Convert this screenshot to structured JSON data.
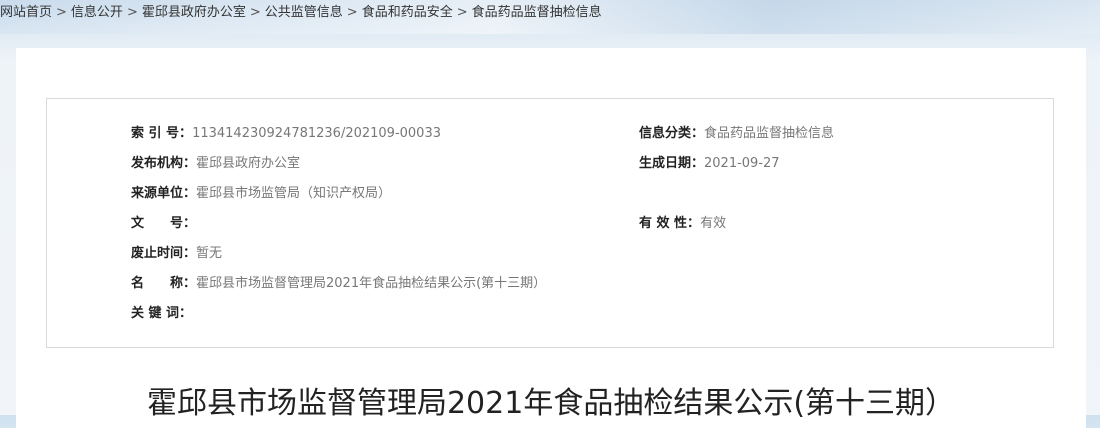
{
  "breadcrumb": {
    "items": [
      "网站首页",
      "信息公开",
      "霍邱县政府办公室",
      "公共监管信息",
      "食品和药品安全",
      "食品药品监督抽检信息"
    ],
    "separator": ">"
  },
  "meta": {
    "index_label": "索 引 号：",
    "index_value": "113414230924781236/202109-00033",
    "category_label": "信息分类：",
    "category_value": "食品药品监督抽检信息",
    "publisher_label": "发布机构：",
    "publisher_value": "霍邱县政府办公室",
    "date_label": "生成日期：",
    "date_value": "2021-09-27",
    "source_label": "来源单位：",
    "source_value": "霍邱县市场监管局（知识产权局）",
    "doc_no_label": "文　　号：",
    "doc_no_value": "",
    "validity_label": "有 效 性：",
    "validity_value": "有效",
    "repeal_label": "废止时间：",
    "repeal_value": "暂无",
    "name_label": "名　　称：",
    "name_value": "霍邱县市场监督管理局2021年食品抽检结果公示(第十三期）",
    "keywords_label": "关 键 词：",
    "keywords_value": ""
  },
  "article": {
    "title": "霍邱县市场监督管理局2021年食品抽检结果公示(第十三期）"
  }
}
